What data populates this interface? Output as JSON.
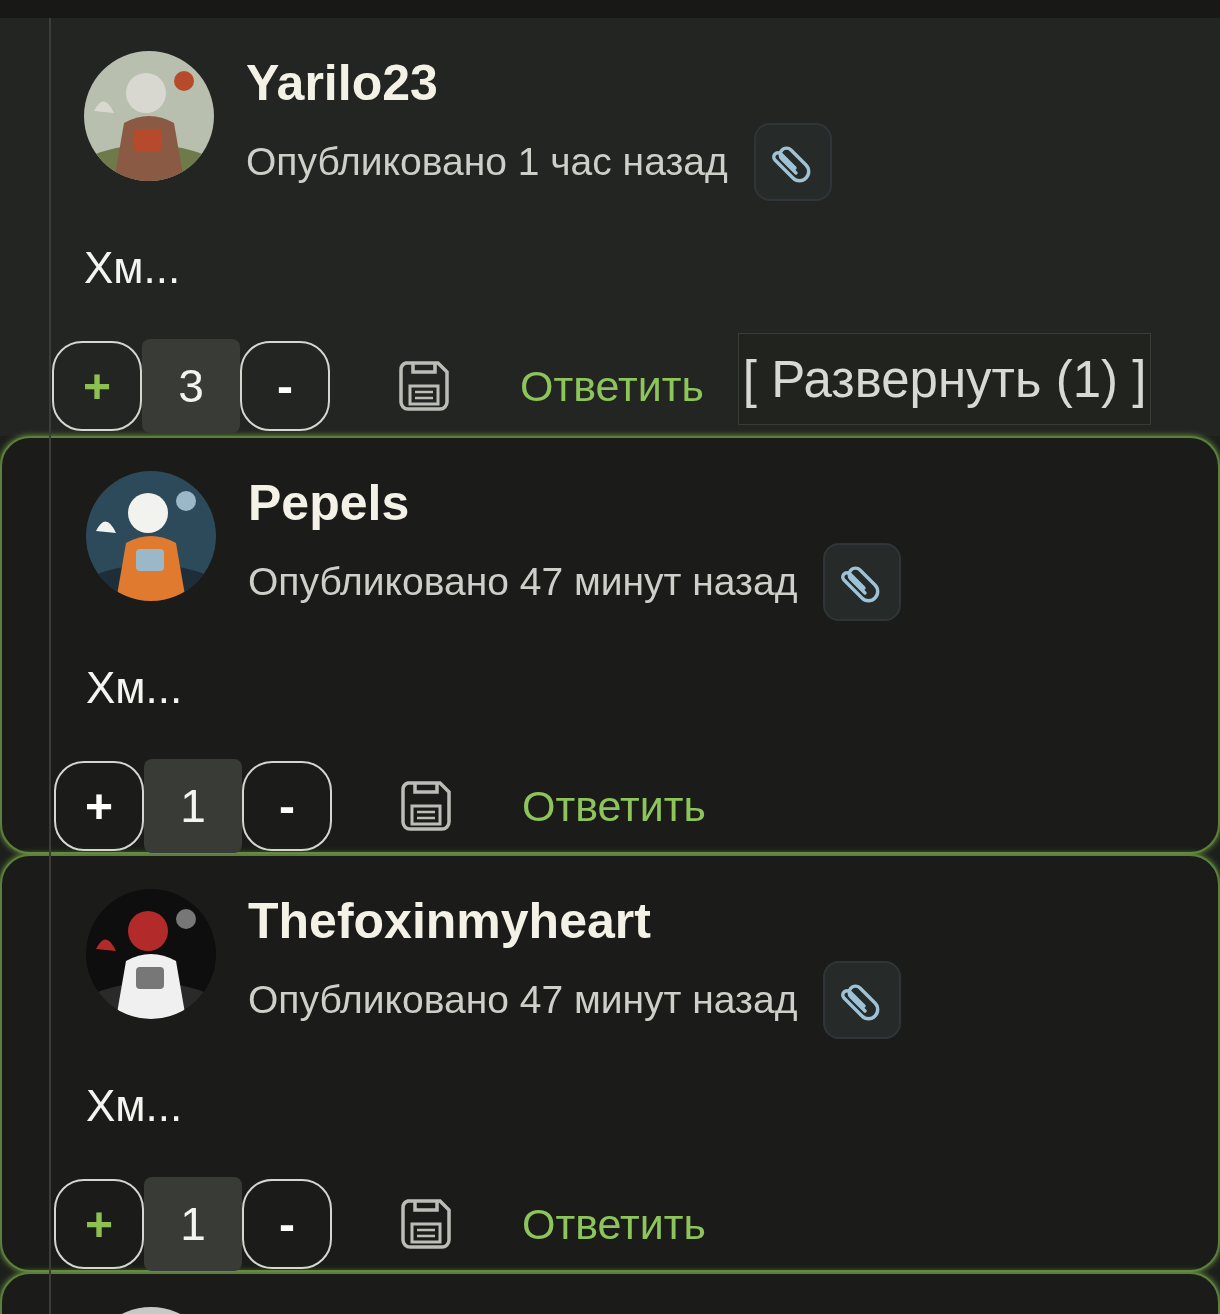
{
  "comments": [
    {
      "card": false,
      "author": "Yarilo23",
      "published": "Опубликовано 1 час назад",
      "text": "Хм...",
      "upvoted": true,
      "score": "3",
      "plus": "+",
      "minus": "-",
      "reply": "Ответить",
      "expand": "[ Развернуть (1) ]"
    },
    {
      "card": true,
      "author": "Pepels",
      "published": "Опубликовано 47 минут назад",
      "text": "Хм...",
      "upvoted": false,
      "score": "1",
      "plus": "+",
      "minus": "-",
      "reply": "Ответить"
    },
    {
      "card": true,
      "author": "Thefoxinmyheart",
      "published": "Опубликовано 47 минут назад",
      "text": "Хм...",
      "upvoted": true,
      "score": "1",
      "plus": "+",
      "minus": "-",
      "reply": "Ответить"
    }
  ]
}
